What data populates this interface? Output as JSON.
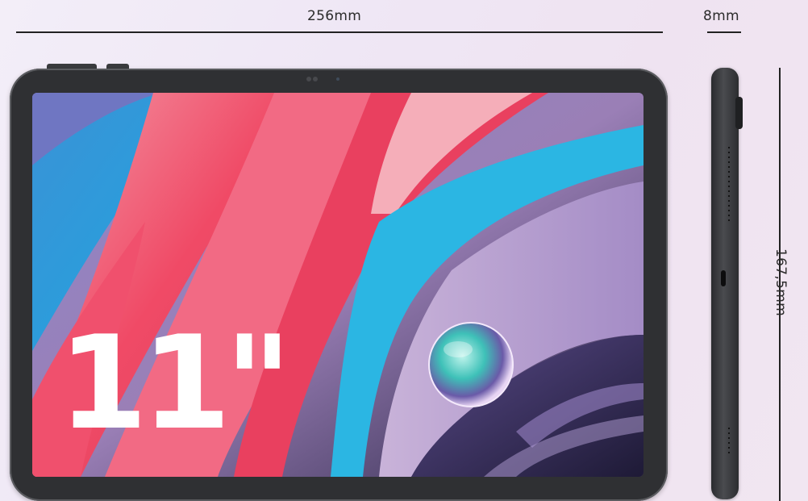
{
  "dimensions": {
    "width_label": "256mm",
    "depth_label": "8mm",
    "height_label": "167,5mm"
  },
  "screen": {
    "size_label": "11\""
  },
  "colors": {
    "bezel": "#2f3033",
    "label": "#2b2b2b",
    "background": "#efe7f5"
  }
}
